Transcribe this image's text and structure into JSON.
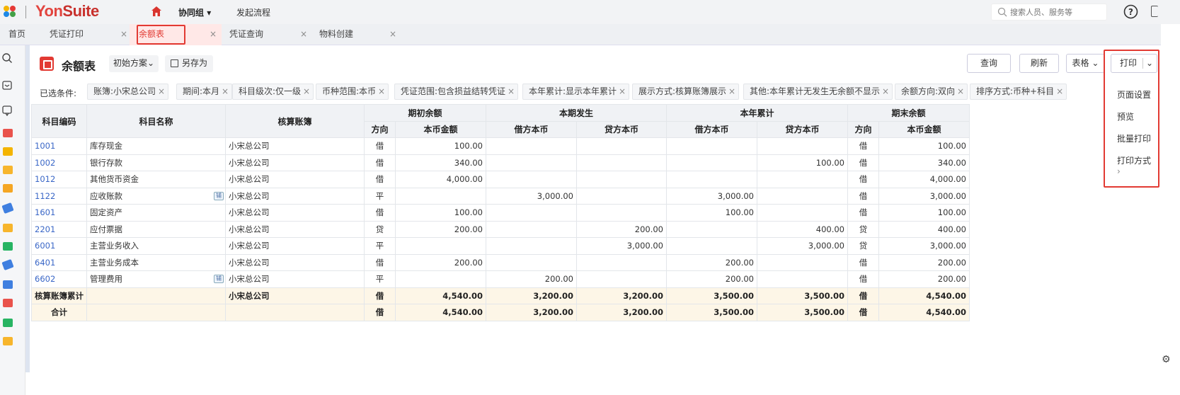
{
  "topbar": {
    "brand_a": "Yon",
    "brand_b": "Suite",
    "group": "协同组",
    "flow": "发起流程",
    "search_placeholder": "搜索人员、服务等"
  },
  "tabs": [
    {
      "label": "首页",
      "closable": false
    },
    {
      "label": "凭证打印",
      "closable": true
    },
    {
      "label": "余额表",
      "closable": true,
      "active": true
    },
    {
      "label": "凭证查询",
      "closable": true
    },
    {
      "label": "物料创建",
      "closable": true
    }
  ],
  "header": {
    "title": "余额表",
    "scheme": "初始方案",
    "save_as": "另存为",
    "query": "查询",
    "refresh": "刷新",
    "view": "表格",
    "print": "打印"
  },
  "print_menu": [
    "页面设置",
    "预览",
    "批量打印",
    "打印方式"
  ],
  "filters": {
    "label": "已选条件:",
    "chips": [
      "账簿:小宋总公司",
      "期间:本月",
      "科目级次:仅一级",
      "币种范围:本币",
      "凭证范围:包含损益结转凭证",
      "本年累计:显示本年累计",
      "展示方式:核算账簿展示",
      "其他:本年累计无发生无余额不显示",
      "余额方向:双向",
      "排序方式:币种+科目"
    ]
  },
  "table": {
    "h_code": "科目编码",
    "h_name": "科目名称",
    "h_book": "核算账簿",
    "h_open": "期初余额",
    "h_period": "本期发生",
    "h_year": "本年累计",
    "h_close": "期末余额",
    "h_dir": "方向",
    "h_amount": "本币金额",
    "h_debit": "借方本币",
    "h_credit": "贷方本币",
    "rows": [
      {
        "code": "1001",
        "name": "库存现金",
        "book": "小宋总公司",
        "odir": "借",
        "oamt": "100.00",
        "pd": "",
        "pc": "",
        "yd": "",
        "yc": "",
        "cdir": "借",
        "camt": "100.00",
        "aux": false
      },
      {
        "code": "1002",
        "name": "银行存款",
        "book": "小宋总公司",
        "odir": "借",
        "oamt": "340.00",
        "pd": "",
        "pc": "",
        "yd": "",
        "yc": "100.00",
        "cdir": "借",
        "camt": "340.00",
        "aux": false
      },
      {
        "code": "1012",
        "name": "其他货币资金",
        "book": "小宋总公司",
        "odir": "借",
        "oamt": "4,000.00",
        "pd": "",
        "pc": "",
        "yd": "",
        "yc": "",
        "cdir": "借",
        "camt": "4,000.00",
        "aux": false
      },
      {
        "code": "1122",
        "name": "应收账款",
        "book": "小宋总公司",
        "odir": "平",
        "oamt": "",
        "pd": "3,000.00",
        "pc": "",
        "yd": "3,000.00",
        "yc": "",
        "cdir": "借",
        "camt": "3,000.00",
        "aux": true
      },
      {
        "code": "1601",
        "name": "固定资产",
        "book": "小宋总公司",
        "odir": "借",
        "oamt": "100.00",
        "pd": "",
        "pc": "",
        "yd": "100.00",
        "yc": "",
        "cdir": "借",
        "camt": "100.00",
        "aux": false
      },
      {
        "code": "2201",
        "name": "应付票据",
        "book": "小宋总公司",
        "odir": "贷",
        "oamt": "200.00",
        "pd": "",
        "pc": "200.00",
        "yd": "",
        "yc": "400.00",
        "cdir": "贷",
        "camt": "400.00",
        "aux": false
      },
      {
        "code": "6001",
        "name": "主营业务收入",
        "book": "小宋总公司",
        "odir": "平",
        "oamt": "",
        "pd": "",
        "pc": "3,000.00",
        "yd": "",
        "yc": "3,000.00",
        "cdir": "贷",
        "camt": "3,000.00",
        "aux": false
      },
      {
        "code": "6401",
        "name": "主营业务成本",
        "book": "小宋总公司",
        "odir": "借",
        "oamt": "200.00",
        "pd": "",
        "pc": "",
        "yd": "200.00",
        "yc": "",
        "cdir": "借",
        "camt": "200.00",
        "aux": false
      },
      {
        "code": "6602",
        "name": "管理费用",
        "book": "小宋总公司",
        "odir": "平",
        "oamt": "",
        "pd": "200.00",
        "pc": "",
        "yd": "200.00",
        "yc": "",
        "cdir": "借",
        "camt": "200.00",
        "aux": true
      }
    ],
    "sum_rows": [
      {
        "code": "核算账簿累计",
        "book": "小宋总公司",
        "odir": "借",
        "oamt": "4,540.00",
        "pd": "3,200.00",
        "pc": "3,200.00",
        "yd": "3,500.00",
        "yc": "3,500.00",
        "cdir": "借",
        "camt": "4,540.00"
      },
      {
        "code": "合计",
        "book": "",
        "odir": "借",
        "oamt": "4,540.00",
        "pd": "3,200.00",
        "pc": "3,200.00",
        "yd": "3,500.00",
        "yc": "3,500.00",
        "cdir": "借",
        "camt": "4,540.00"
      }
    ],
    "aux_label": "辅"
  },
  "colors": {
    "accent": "#e23a33",
    "link": "#3a67c7",
    "sum_bg": "#fdf6e7"
  }
}
